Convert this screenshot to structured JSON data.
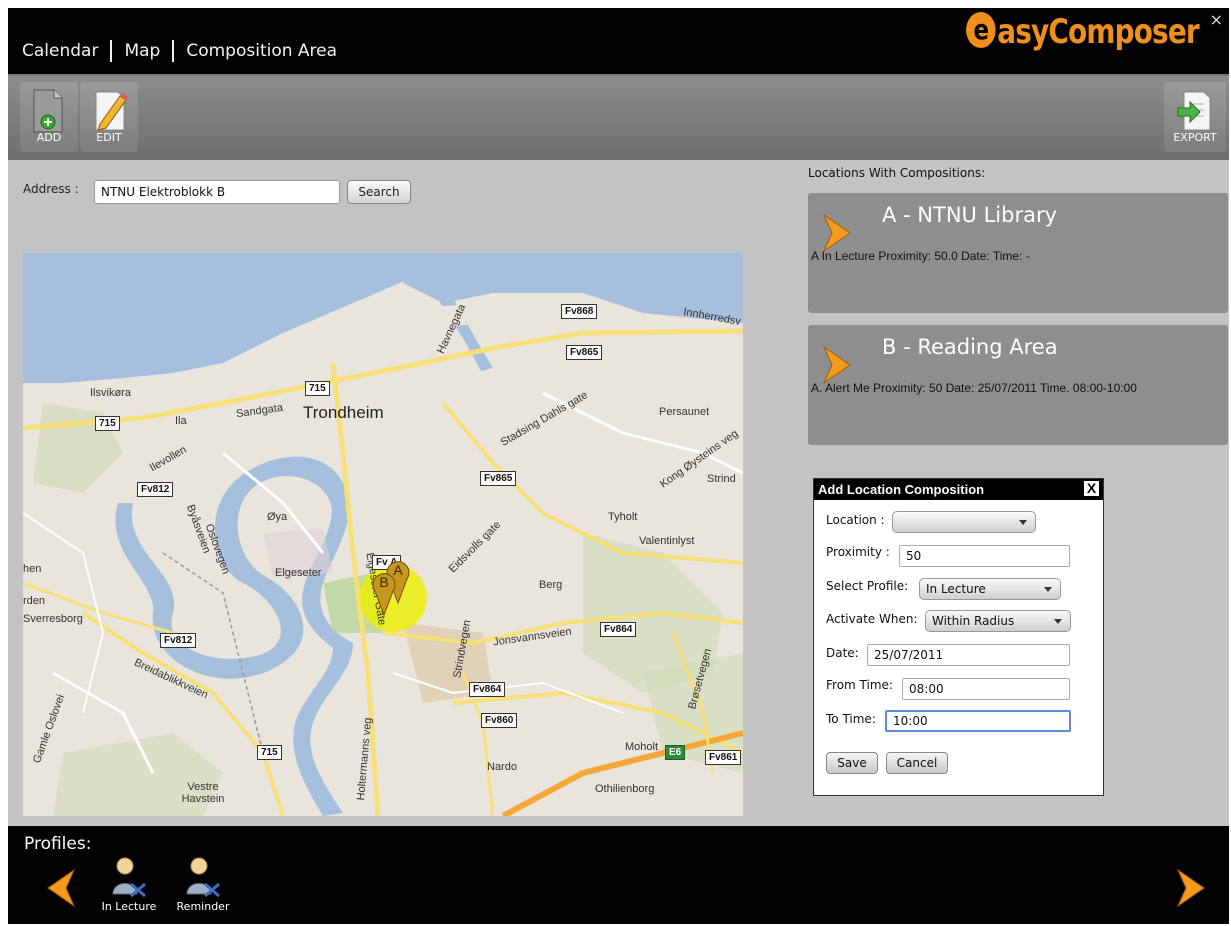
{
  "header": {
    "nav": [
      "Calendar",
      "Map",
      "Composition Area"
    ],
    "logo_text": "asyComposer",
    "logo_initial": "e",
    "close_label": "×"
  },
  "toolbar": {
    "add_label": "ADD",
    "edit_label": "EDIT",
    "export_label": "EXPORT"
  },
  "address": {
    "label": "Address :",
    "value": "NTNU Elektroblokk B",
    "search_label": "Search"
  },
  "map": {
    "labels": {
      "ilsvikora": "Ilsvikøra",
      "ila": "Ila",
      "sandgata": "Sandgata",
      "trondheim": "Trondheim",
      "persaunet": "Persaunet",
      "strind": "Strind",
      "ilevollen": "Ilevollen",
      "oya": "Øya",
      "tyholt": "Tyholt",
      "valentinlyst": "Valentinlyst",
      "elgeseter": "Elgeseter",
      "berg": "Berg",
      "sverresborg": "Sverresborg",
      "moholt": "Moholt",
      "nardo": "Nardo",
      "othilienborg": "Othilienborg",
      "vestre_havstein": "Vestre Havstein",
      "innherredsv": "Innherredsv",
      "havnegata": "Havnegata",
      "stadsing": "Stadsing Dahls gate",
      "eidsvolls": "Eidsvolls gate",
      "elgeseter_gate": "Elgeseter Gate",
      "jonsvannsveien": "Jonsvannsveien",
      "strindvegen": "Strindvegen",
      "holtermanns": "Holtermanns veg",
      "byasveien": "Byåsveien",
      "oslovegen": "Oslovegen",
      "breidablikk": "Breidablikkveien",
      "kong_oystein": "Kong Øysteins veg",
      "brosetvegen": "Brøsetvegen",
      "gamle_oslovei": "Gamle Oslovei",
      "hen": "hen",
      "rden": "rden"
    },
    "shields": {
      "fv868": "Fv868",
      "fv865a": "Fv865",
      "fv865b": "Fv865",
      "r715a": "715",
      "r715b": "715",
      "fv812a": "Fv812",
      "fv812b": "Fv812",
      "fv864a": "Fv864",
      "fv864b": "Fv864",
      "fv860": "Fv860",
      "r715c": "715",
      "e6": "E6",
      "fv861": "Fv861",
      "fva": "Fv A"
    },
    "marker_a": "A",
    "marker_b": "B"
  },
  "locations": {
    "title": "Locations With Compositions:",
    "cards": [
      {
        "name": "A - NTNU Library",
        "desc": "A In Lecture Proximity: 50.0 Date:  Time: -"
      },
      {
        "name": "B - Reading Area",
        "desc": "A. Alert Me Proximity: 50 Date: 25/07/2011 Time. 08:00-10:00"
      }
    ]
  },
  "dialog": {
    "title": "Add Location Composition",
    "close": "X",
    "location_label": "Location :",
    "location_value": "",
    "proximity_label": "Proximity :",
    "proximity_value": "50",
    "profile_label": "Select Profile:",
    "profile_value": "In Lecture",
    "activate_label": "Activate When:",
    "activate_value": "Within Radius",
    "date_label": "Date:",
    "date_value": "25/07/2011",
    "from_label": "From Time:",
    "from_value": "08:00",
    "to_label": "To Time:",
    "to_value": "10:00",
    "save_label": "Save",
    "cancel_label": "Cancel"
  },
  "profiles": {
    "title": "Profiles:",
    "items": [
      {
        "label": "In Lecture"
      },
      {
        "label": "Reminder"
      }
    ]
  },
  "colors": {
    "accent": "#f0901a",
    "header_bg": "#020202",
    "panel_bg": "#c3c3c3",
    "card_bg": "#8e8e8e"
  }
}
